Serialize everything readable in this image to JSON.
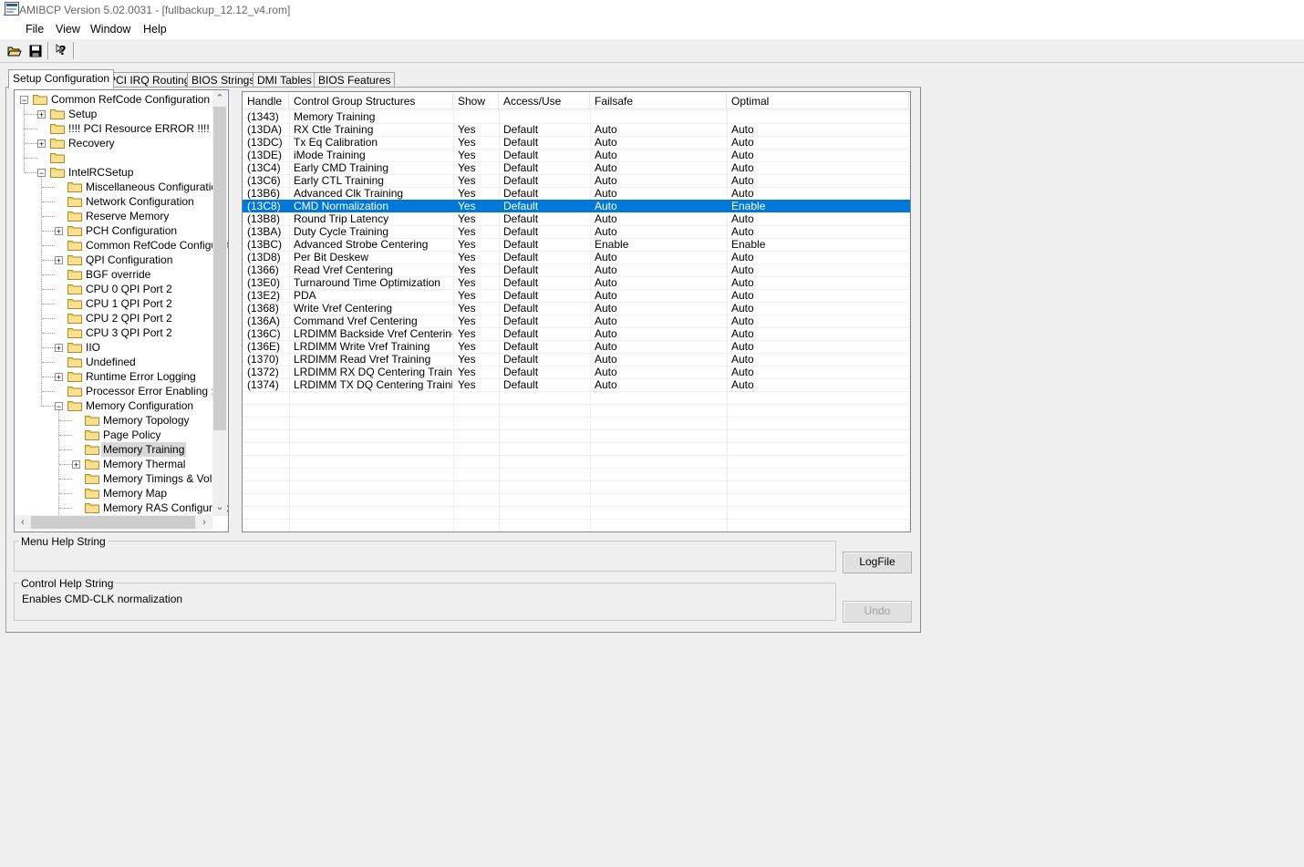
{
  "window": {
    "title": "AMIBCP Version 5.02.0031 - [fullbackup_12.12_v4.rom]"
  },
  "menu": [
    "File",
    "View",
    "Window",
    "Help"
  ],
  "tabs": [
    "Setup Configuration",
    "PCI IRQ Routing",
    "BIOS Strings",
    "DMI Tables",
    "BIOS Features"
  ],
  "tree": [
    {
      "label": "Common RefCode Configuration",
      "level": 0,
      "expander": "-"
    },
    {
      "label": "Setup",
      "level": 1,
      "expander": "+"
    },
    {
      "label": "!!!! PCI Resource ERROR !!!!",
      "level": 1,
      "expander": ""
    },
    {
      "label": "Recovery",
      "level": 1,
      "expander": "+"
    },
    {
      "label": "",
      "level": 1,
      "expander": ""
    },
    {
      "label": "IntelRCSetup",
      "level": 1,
      "expander": "-"
    },
    {
      "label": "Miscellaneous Configuration",
      "level": 2,
      "expander": ""
    },
    {
      "label": "Network Configuration",
      "level": 2,
      "expander": ""
    },
    {
      "label": "Reserve Memory",
      "level": 2,
      "expander": ""
    },
    {
      "label": "PCH Configuration",
      "level": 2,
      "expander": "+"
    },
    {
      "label": "Common RefCode Configurati",
      "level": 2,
      "expander": ""
    },
    {
      "label": "QPI Configuration",
      "level": 2,
      "expander": "+"
    },
    {
      "label": "BGF override",
      "level": 2,
      "expander": ""
    },
    {
      "label": "CPU 0 QPI Port 2",
      "level": 2,
      "expander": ""
    },
    {
      "label": "CPU 1 QPI Port 2",
      "level": 2,
      "expander": ""
    },
    {
      "label": "CPU 2 QPI Port 2",
      "level": 2,
      "expander": ""
    },
    {
      "label": "CPU 3 QPI Port 2",
      "level": 2,
      "expander": ""
    },
    {
      "label": "IIO",
      "level": 2,
      "expander": "+"
    },
    {
      "label": "Undefined",
      "level": 2,
      "expander": ""
    },
    {
      "label": "Runtime Error Logging",
      "level": 2,
      "expander": "+"
    },
    {
      "label": "Processor Error Enabling :",
      "level": 2,
      "expander": ""
    },
    {
      "label": "Memory Configuration",
      "level": 2,
      "expander": "-"
    },
    {
      "label": "Memory Topology",
      "level": 3,
      "expander": ""
    },
    {
      "label": "Page Policy",
      "level": 3,
      "expander": ""
    },
    {
      "label": "Memory Training",
      "level": 3,
      "expander": "",
      "selected": true
    },
    {
      "label": "Memory Thermal",
      "level": 3,
      "expander": "+"
    },
    {
      "label": "Memory Timings & Voltag",
      "level": 3,
      "expander": ""
    },
    {
      "label": "Memory Map",
      "level": 3,
      "expander": ""
    },
    {
      "label": "Memory RAS Configuratic",
      "level": 3,
      "expander": ""
    }
  ],
  "columns": [
    "Handle",
    "Control Group Structures",
    "Show",
    "Access/Use",
    "Failsafe",
    "Optimal"
  ],
  "rows": [
    [
      "(1343)",
      "Memory Training",
      "",
      "",
      "",
      ""
    ],
    [
      "(13DA)",
      "RX Ctle Training",
      "Yes",
      "Default",
      "Auto",
      "Auto"
    ],
    [
      "(13DC)",
      "Tx Eq Calibration",
      "Yes",
      "Default",
      "Auto",
      "Auto"
    ],
    [
      "(13DE)",
      "iMode Training",
      "Yes",
      "Default",
      "Auto",
      "Auto"
    ],
    [
      "(13C4)",
      "Early CMD Training",
      "Yes",
      "Default",
      "Auto",
      "Auto"
    ],
    [
      "(13C6)",
      "Early CTL Training",
      "Yes",
      "Default",
      "Auto",
      "Auto"
    ],
    [
      "(13B6)",
      "Advanced Clk Training",
      "Yes",
      "Default",
      "Auto",
      "Auto"
    ],
    [
      "(13C8)",
      "CMD Normalization",
      "Yes",
      "Default",
      "Auto",
      "Enable"
    ],
    [
      "(13B8)",
      "Round Trip Latency",
      "Yes",
      "Default",
      "Auto",
      "Auto"
    ],
    [
      "(13BA)",
      "Duty Cycle Training",
      "Yes",
      "Default",
      "Auto",
      "Auto"
    ],
    [
      "(13BC)",
      "Advanced Strobe Centering",
      "Yes",
      "Default",
      "Enable",
      "Enable"
    ],
    [
      "(13D8)",
      "Per Bit Deskew",
      "Yes",
      "Default",
      "Auto",
      "Auto"
    ],
    [
      "(1366)",
      "Read Vref Centering",
      "Yes",
      "Default",
      "Auto",
      "Auto"
    ],
    [
      "(13E0)",
      "Turnaround Time Optimization",
      "Yes",
      "Default",
      "Auto",
      "Auto"
    ],
    [
      "(13E2)",
      "PDA",
      "Yes",
      "Default",
      "Auto",
      "Auto"
    ],
    [
      "(1368)",
      "Write Vref Centering",
      "Yes",
      "Default",
      "Auto",
      "Auto"
    ],
    [
      "(136A)",
      "Command Vref Centering",
      "Yes",
      "Default",
      "Auto",
      "Auto"
    ],
    [
      "(136C)",
      "LRDIMM Backside Vref Centering",
      "Yes",
      "Default",
      "Auto",
      "Auto"
    ],
    [
      "(136E)",
      "LRDIMM Write Vref Training",
      "Yes",
      "Default",
      "Auto",
      "Auto"
    ],
    [
      "(1370)",
      "LRDIMM Read Vref Training",
      "Yes",
      "Default",
      "Auto",
      "Auto"
    ],
    [
      "(1372)",
      "LRDIMM RX DQ Centering Traini...",
      "Yes",
      "Default",
      "Auto",
      "Auto"
    ],
    [
      "(1374)",
      "LRDIMM TX DQ Centering Training",
      "Yes",
      "Default",
      "Auto",
      "Auto"
    ]
  ],
  "selected_row": 7,
  "menu_help": {
    "title": "Menu Help String",
    "text": ""
  },
  "control_help": {
    "title": "Control Help String",
    "text": "Enables CMD-CLK normalization"
  },
  "buttons": {
    "logfile": "LogFile",
    "undo": "Undo"
  },
  "toolbar": [
    "open-folder-icon",
    "save-icon",
    "context-help-icon"
  ],
  "colors": {
    "selection": "#0078d7",
    "tree_selected": "#d9d9d9",
    "folder": "#f2d36b"
  }
}
